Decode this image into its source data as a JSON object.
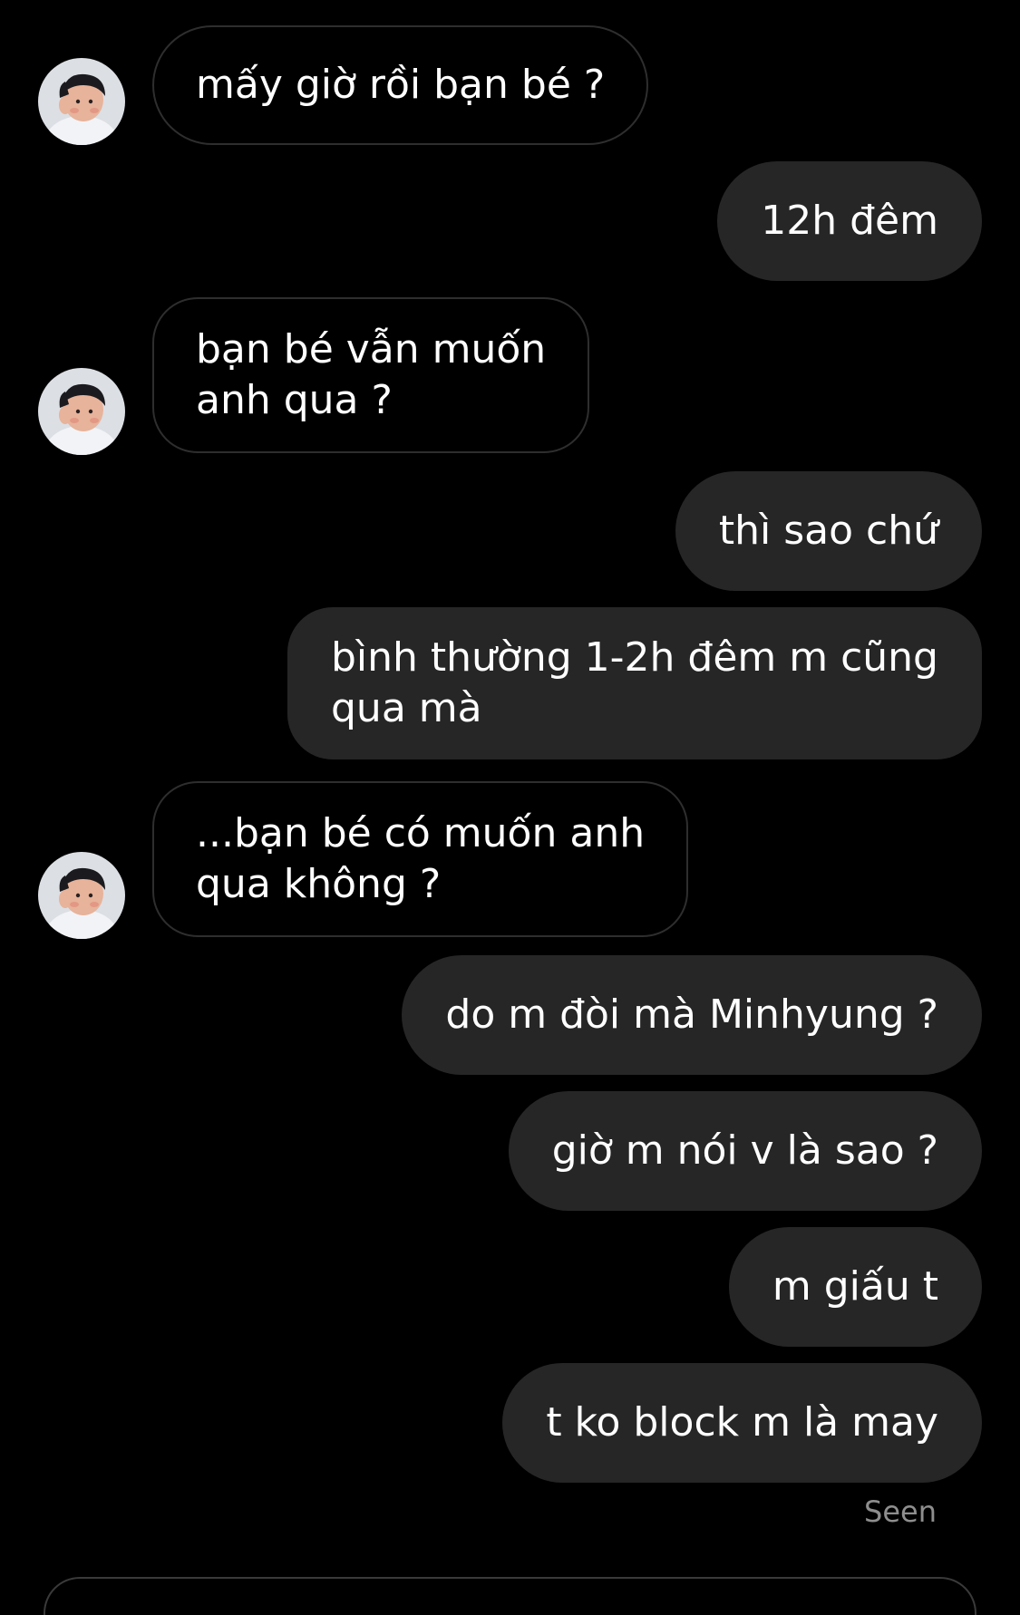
{
  "colors": {
    "background": "#000000",
    "outgoing_bubble": "#262626",
    "incoming_border": "#2e2e2e",
    "seen_text": "#8e8e8e"
  },
  "contact": {
    "avatar_icon": "child-portrait-avatar"
  },
  "messages": [
    {
      "from": "them",
      "lines": [
        "mấy giờ rồi bạn bé ?"
      ]
    },
    {
      "from": "me",
      "lines": [
        "12h đêm"
      ]
    },
    {
      "from": "them",
      "lines": [
        "bạn bé vẫn muốn",
        "anh qua ?"
      ]
    },
    {
      "from": "me",
      "lines": [
        "thì sao chứ"
      ]
    },
    {
      "from": "me",
      "lines": [
        "bình thường 1-2h đêm m cũng",
        "qua mà"
      ]
    },
    {
      "from": "them",
      "lines": [
        "...bạn bé có muốn anh",
        "qua không ?"
      ]
    },
    {
      "from": "me",
      "lines": [
        "do m đòi mà Minhyung ?"
      ]
    },
    {
      "from": "me",
      "lines": [
        "giờ m nói v là sao ?"
      ]
    },
    {
      "from": "me",
      "lines": [
        "m giấu t"
      ]
    },
    {
      "from": "me",
      "lines": [
        "t ko block m là may"
      ]
    }
  ],
  "status": {
    "seen_label": "Seen"
  }
}
